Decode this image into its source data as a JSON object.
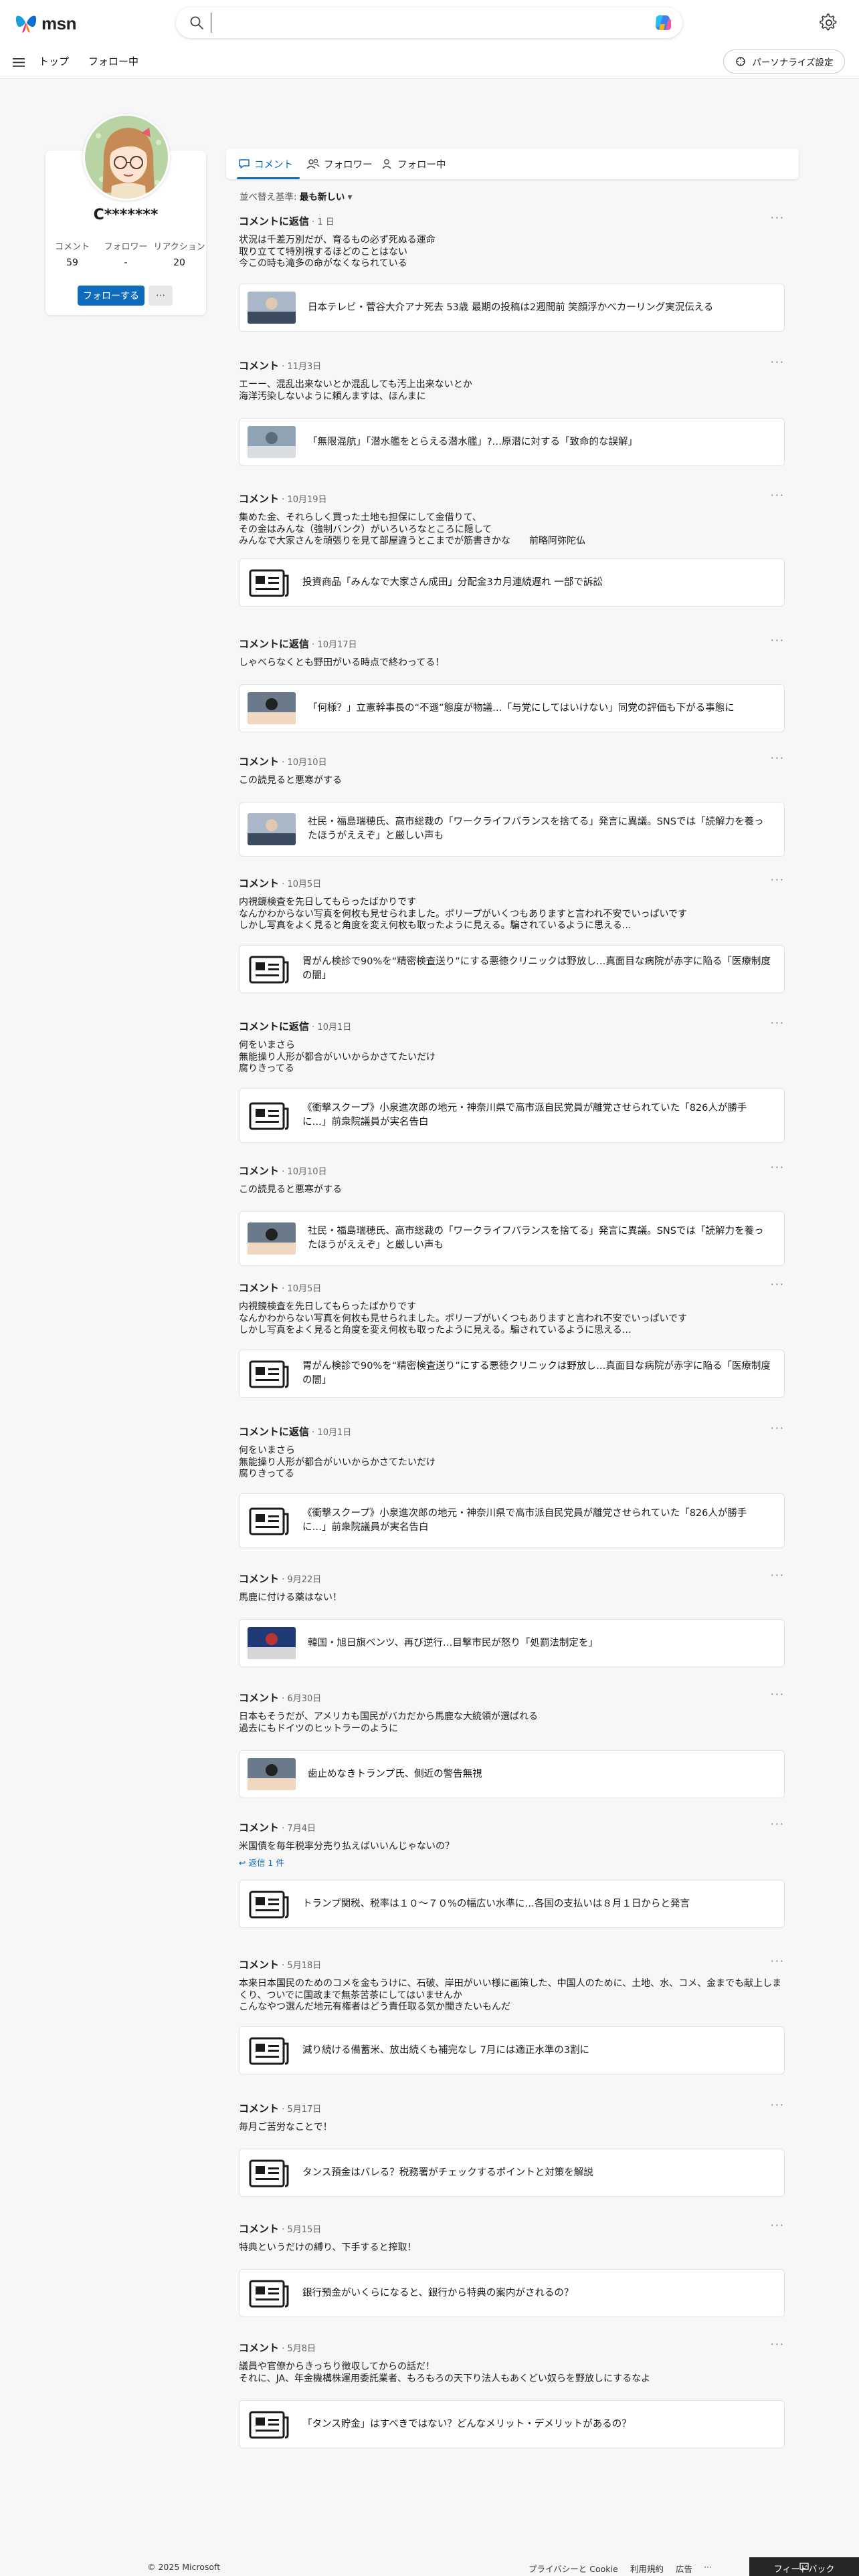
{
  "header": {
    "logo_text": "msn",
    "search_placeholder": "",
    "nav": [
      "トップ",
      "フォロー中"
    ],
    "personalize_label": "パーソナライズ設定"
  },
  "profile": {
    "name": "C*******",
    "stats": [
      {
        "label": "コメント",
        "value": "59"
      },
      {
        "label": "フォロワー",
        "value": "-"
      },
      {
        "label": "リアクション",
        "value": "20"
      }
    ],
    "follow_label": "フォローする",
    "more_label": "···"
  },
  "tabs": [
    {
      "label": "コメント",
      "icon": "comment-icon"
    },
    {
      "label": "フォロワー",
      "icon": "followers-icon"
    },
    {
      "label": "フォロー中",
      "icon": "following-icon"
    }
  ],
  "sort": {
    "label": "並べ替え基準:",
    "value": "最も新しい"
  },
  "entries": [
    {
      "type": "コメントに返信",
      "date": "1 日",
      "body": "状況は千差万別だが、育るもの必ず死ぬる運命\n取り立てて特別視するほどのことはない\n今この時も滝多の命がなくなられている",
      "article": "日本テレビ・菅谷大介アナ死去 53歳 最期の投稿は2週間前 笑顔浮かべカーリング実況伝える",
      "thumb": "photo"
    },
    {
      "type": "コメント",
      "date": "11月3日",
      "body": "エーー、混乱出来ないとか混乱しても汚上出来ないとか\n海洋汚染しないように頼んますは、ほんまに",
      "article": "「無限混航」「潜水艦をとらえる潜水艦」?…原潜に対する「致命的な誤解」",
      "thumb": "photo"
    },
    {
      "type": "コメント",
      "date": "10月19日",
      "body": "集めた金、それらしく買った土地も担保にして金借りて、\nその金はみんな（強制バンク）がいろいろなところに隠して\nみんなで大家さんを頑張りを見て部屋違うとこまでが筋書きかな　　前略阿弥陀仏",
      "article": "投資商品「みんなで大家さん成田」分配金3カ月連続遅れ 一部で訴訟",
      "thumb": "news"
    },
    {
      "type": "コメントに返信",
      "date": "10月17日",
      "body": "しゃべらなくとも野田がいる時点で終わってる！",
      "article": "「何様？」立憲幹事長の“不遜”態度が物議…「与党にしてはいけない」同党の評価も下がる事態に",
      "thumb": "photo"
    },
    {
      "type": "コメント",
      "date": "10月10日",
      "body": "この読見ると悪寒がする",
      "article": "社民・福島瑞穂氏、高市総裁の「ワークライフバランスを捨てる」発言に異議。SNSでは「読解力を養ったほうがええぞ」と厳しい声も",
      "thumb": "photo",
      "tall": true
    },
    {
      "type": "コメント",
      "date": "10月5日",
      "body": "内視鏡検査を先日してもらったばかりです\nなんかわからない写真を何枚も見せられました。ポリープがいくつもありますと言われ不安でいっぱいです\nしかし写真をよく見ると角度を変え何枚も取ったように見える。騙されているように思える…",
      "article": "胃がん検診で90%を“精密検査送り”にする悪徳クリニックは野放し…真面目な病院が赤字に陥る「医療制度の闇」",
      "thumb": "news"
    },
    {
      "type": "コメントに返信",
      "date": "10月1日",
      "body": "何をいまさら\n無能操り人形が都合がいいからかさてたいだけ\n腐りきってる",
      "article": "《衝撃スクープ》小泉進次郎の地元・神奈川県で高市派自民党員が離党させられていた「826人が勝手に…」前衆院議員が実名告白",
      "thumb": "news",
      "tall": true
    },
    {
      "type": "コメント",
      "date": "10月10日",
      "body": "この読見ると悪寒がする",
      "article": "社民・福島瑞穂氏、高市総裁の「ワークライフバランスを捨てる」発言に異議。SNSでは「読解力を養ったほうがええぞ」と厳しい声も",
      "thumb": "photo",
      "tall": true
    },
    {
      "type": "コメント",
      "date": "10月5日",
      "body": "内視鏡検査を先日してもらったばかりです\nなんかわからない写真を何枚も見せられました。ポリープがいくつもありますと言われ不安でいっぱいです\nしかし写真をよく見ると角度を変え何枚も取ったように見える。騙されているように思える…",
      "article": "胃がん検診で90%を“精密検査送り”にする悪徳クリニックは野放し…真面目な病院が赤字に陥る「医療制度の闇」",
      "thumb": "news"
    },
    {
      "type": "コメントに返信",
      "date": "10月1日",
      "body": "何をいまさら\n無能操り人形が都合がいいからかさてたいだけ\n腐りきってる",
      "article": "《衝撃スクープ》小泉進次郎の地元・神奈川県で高市派自民党員が離党させられていた「826人が勝手に…」前衆院議員が実名告白",
      "thumb": "news",
      "tall": true
    },
    {
      "type": "コメント",
      "date": "9月22日",
      "body": "馬鹿に付ける薬はない！",
      "article": "韓国・旭日旗ベンツ、再び逆行…目撃市民が怒り「処罰法制定を」",
      "thumb": "photo"
    },
    {
      "type": "コメント",
      "date": "6月30日",
      "body": "日本もそうだが、アメリカも国民がバカだから馬鹿な大統領が選ばれる\n過去にもドイツのヒットラーのように",
      "article": "歯止めなきトランプ氏、側近の警告無視",
      "thumb": "photo"
    },
    {
      "type": "コメント",
      "date": "7月4日",
      "body": "米国債を毎年税率分売り払えばいいんじゃないの？",
      "reply": "返信 1 件",
      "article": "トランプ関税、税率は１０〜７０%の幅広い水準に…各国の支払いは８月１日からと発言",
      "thumb": "news"
    },
    {
      "type": "コメント",
      "date": "5月18日",
      "body": "本来日本国民のためのコメを金もうけに、石破、岸田がいい様に画策した、中国人のために、土地、水、コメ、金までも献上しまくり、ついでに国政まで無茶苦茶にしてはいませんか\nこんなやつ選んだ地元有権者はどう責任取る気か聞きたいもんだ",
      "article": "減り続ける備蓄米、放出続くも補完なし 7月には適正水準の3割に",
      "thumb": "news"
    },
    {
      "type": "コメント",
      "date": "5月17日",
      "body": "毎月ご苦労なことで！",
      "article": "タンス預金はバレる？税務署がチェックするポイントと対策を解説",
      "thumb": "news"
    },
    {
      "type": "コメント",
      "date": "5月15日",
      "body": "特典というだけの縛り、下手すると搾取！",
      "article": "銀行預金がいくらになると、銀行から特典の案内がされるの？",
      "thumb": "news"
    },
    {
      "type": "コメント",
      "date": "5月8日",
      "body": "議員や官僚からきっちり徴収してからの話だ！\nそれに、JA、年金機構株運用委託業者、もろもろの天下り法人もあくどい奴らを野放しにするなよ",
      "article": "「タンス貯金」はすべきではない？どんなメリット・デメリットがあるの？",
      "thumb": "news"
    }
  ],
  "footer": {
    "copyright": "© 2025 Microsoft",
    "links": [
      "プライバシーと Cookie",
      "利用規約",
      "広告"
    ],
    "more": "···",
    "feedback": "フィードバック"
  },
  "colors": {
    "accent": "#0f6cbd",
    "background": "#f7f7f7"
  }
}
